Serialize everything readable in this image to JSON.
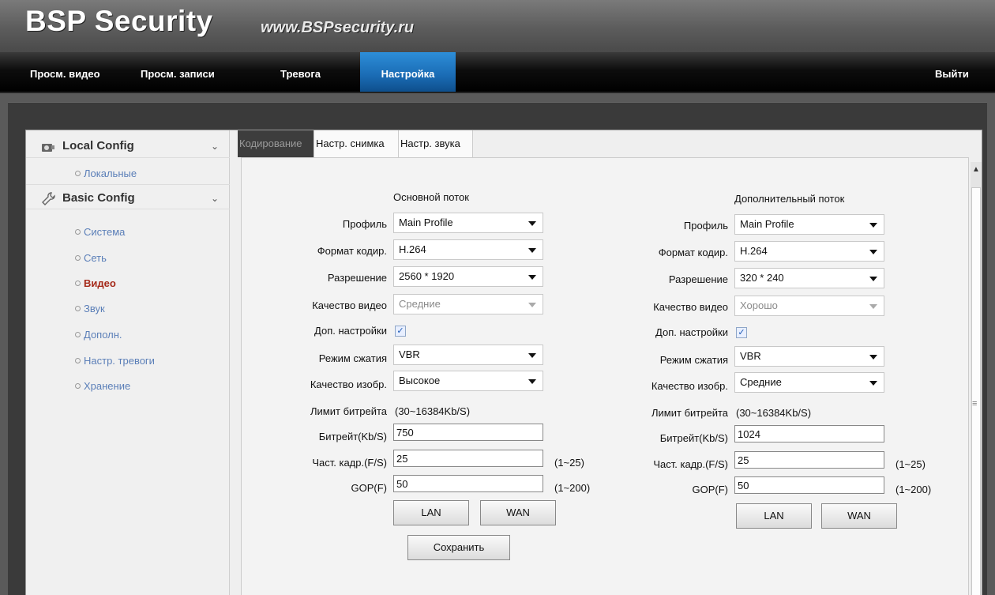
{
  "header": {
    "brand": "BSP Security",
    "site": "www.BSPsecurity.ru"
  },
  "nav": {
    "items": [
      {
        "label": "Просм. видео"
      },
      {
        "label": "Просм. записи"
      },
      {
        "label": "Тревога"
      },
      {
        "label": "Настройка",
        "active": true
      }
    ],
    "logout": "Выйти"
  },
  "sidebar": {
    "groups": [
      {
        "title": "Local Config",
        "icon": "camera-icon",
        "items": [
          {
            "label": "Локальные"
          }
        ]
      },
      {
        "title": "Basic Config",
        "icon": "wrench-icon",
        "items": [
          {
            "label": "Система"
          },
          {
            "label": "Сеть"
          },
          {
            "label": "Видео",
            "active": true
          },
          {
            "label": "Звук"
          },
          {
            "label": "Дополн."
          },
          {
            "label": "Настр. тревоги"
          },
          {
            "label": "Хранение"
          }
        ]
      }
    ]
  },
  "tabs": [
    {
      "label": "Кодирование",
      "active": true
    },
    {
      "label": "Настр. снимка"
    },
    {
      "label": "Настр. звука"
    }
  ],
  "labels": {
    "profile": "Профиль",
    "codec": "Формат кодир.",
    "resolution": "Разрешение",
    "quality": "Качество видео",
    "advanced": "Доп. настройки",
    "mode": "Режим сжатия",
    "img_quality": "Качество изобр.",
    "bitrate_limit": "Лимит битрейта",
    "bitrate": "Битрейт(Kb/S)",
    "fps": "Част. кадр.(F/S)",
    "gop": "GOP(F)"
  },
  "main_stream": {
    "title": "Основной поток",
    "profile": "Main Profile",
    "codec": "H.264",
    "resolution": "2560 * 1920",
    "quality": "Средние",
    "advanced_checked": true,
    "mode": "VBR",
    "img_quality": "Высокое",
    "bitrate_limit": "(30~16384Kb/S)",
    "bitrate": "750",
    "fps": "25",
    "fps_range": "(1~25)",
    "gop": "50",
    "gop_range": "(1~200)",
    "lan": "LAN",
    "wan": "WAN"
  },
  "sub_stream": {
    "title": "Дополнительный поток",
    "profile": "Main Profile",
    "codec": "H.264",
    "resolution": "320 * 240",
    "quality": "Хорошо",
    "advanced_checked": true,
    "mode": "VBR",
    "img_quality": "Средние",
    "bitrate_limit": "(30~16384Kb/S)",
    "bitrate": "1024",
    "fps": "25",
    "fps_range": "(1~25)",
    "gop": "50",
    "gop_range": "(1~200)",
    "lan": "LAN",
    "wan": "WAN"
  },
  "save": "Сохранить"
}
